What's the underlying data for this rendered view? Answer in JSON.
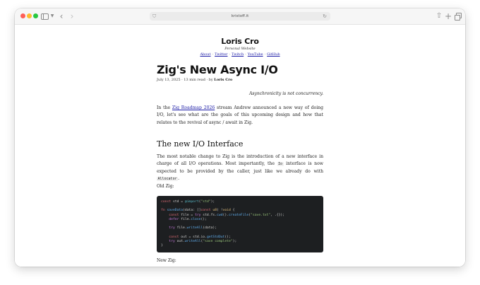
{
  "browser": {
    "url": "kristoff.it"
  },
  "site": {
    "title": "Loris Cro",
    "subtitle": "Personal Website",
    "nav": [
      "About",
      "Twitter",
      "Twitch",
      "YouTube",
      "GitHub"
    ]
  },
  "post": {
    "title": "Zig's New Async I/O",
    "meta_prefix": "July 13, 2025 · 13 min read · by ",
    "author": "Loris Cro",
    "epigraph": "Asynchronicity is not concurrency.",
    "p1_before": "In the ",
    "p1_link": "Zig Roadmap 2026",
    "p1_after": " stream Andrew announced a new way of doing I/O, let's see what are the goals of this upcoming design and how that relates to the revival of async / await in Zig.",
    "section_heading": "The new I/O Interface",
    "p2_a": "The most notable change to Zig is the introduction of a new interface in charge of all I/O operations. Most importantly, the ",
    "p2_code1": "Io",
    "p2_b": " interface is now expected to be provided by the caller, just like we already do with ",
    "p2_code2": "Allocator",
    "p2_c": ".",
    "old_label": "Old Zig:",
    "new_label": "New Zig:",
    "code_lines": [
      "const std = @import(\"std\");",
      "",
      "fn saveData(data: []const u8) !void {",
      "    const file = try std.fs.cwd().createFile(\"save.txt\", .{});",
      "    defer file.close();",
      "",
      "    try file.writeAll(data);",
      "",
      "    const out = std.io.getStdOut();",
      "    try out.writeAll(\"save complete\");",
      "}"
    ]
  }
}
